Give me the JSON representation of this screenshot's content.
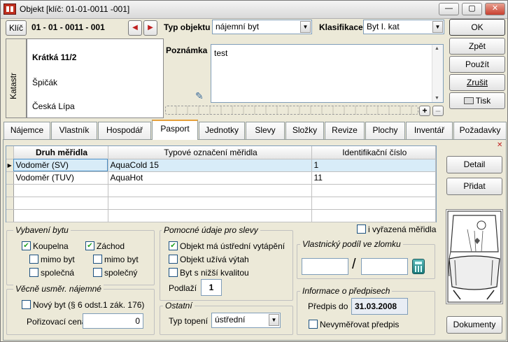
{
  "window": {
    "title": "Objekt  [klíč: 01-01-0011 -001]",
    "min_glyph": "—",
    "max_glyph": "▢",
    "close_glyph": "✕"
  },
  "header": {
    "key_button": "Klíč",
    "key_value": "01 - 01 - 0011 - 001",
    "prev_glyph": "◀",
    "next_glyph": "▶",
    "type_label": "Typ objektu",
    "type_value": "nájemní byt",
    "class_label": "Klasifikace",
    "class_value": "Byt I. kat"
  },
  "katastr": {
    "side_label": "Katastr",
    "street": "Krátká 11/2",
    "district": "Špičák",
    "city": "Česká Lípa"
  },
  "note": {
    "label": "Poznámka",
    "value": "test",
    "plus": "+",
    "minus": "–"
  },
  "actions": {
    "ok": "OK",
    "back": "Zpět",
    "use": "Použít",
    "cancel": "Zrušit",
    "print": "Tisk"
  },
  "tabs": [
    {
      "label": "Nájemce"
    },
    {
      "label": "Vlastník"
    },
    {
      "label": "Hospodář"
    },
    {
      "label": "Pasport"
    },
    {
      "label": "Jednotky"
    },
    {
      "label": "Slevy"
    },
    {
      "label": "Složky"
    },
    {
      "label": "Revize"
    },
    {
      "label": "Plochy"
    },
    {
      "label": "Inventář"
    },
    {
      "label": "Požadavky"
    }
  ],
  "meters": {
    "columns": [
      "Druh měřidla",
      "Typové označení měřidla",
      "Identifikační číslo"
    ],
    "rows": [
      {
        "type": "Vodoměr (SV)",
        "model": "AquaCold 15",
        "id": "1"
      },
      {
        "type": "Vodoměr (TUV)",
        "model": "AquaHot",
        "id": "11"
      }
    ],
    "detail_button": "Detail",
    "add_button": "Přidat",
    "include_removed": "i vyřazená měřidla"
  },
  "equipment": {
    "title": "Vybavení bytu",
    "bathroom": "Koupelna",
    "toilet": "Záchod",
    "outside_flat_1": "mimo byt",
    "outside_flat_2": "mimo byt",
    "shared_1": "společná",
    "shared_2": "společný"
  },
  "rent": {
    "title": "Věcně usměr. nájemné",
    "new_flat": "Nový byt (§  6 odst.1 zák. 176)",
    "purchase_label": "Pořizovací cena",
    "purchase_value": "0"
  },
  "discounts": {
    "title": "Pomocné údaje pro slevy",
    "central_heating": "Objekt má ústřední vytápění",
    "elevator": "Objekt užívá výtah",
    "lower_quality": "Byt s nižší kvalitou",
    "floor_label": "Podlaží",
    "floor_value": "1"
  },
  "other": {
    "title": "Ostatní",
    "heating_label": "Typ topení",
    "heating_value": "ústřední"
  },
  "ownership": {
    "title": "Vlastnický podíl ve zlomku",
    "numerator": "",
    "slash": "/",
    "denominator": ""
  },
  "prescriptions": {
    "title": "Informace o předpisech",
    "date_label": "Předpis do",
    "date_value": "31.03.2008",
    "no_measure": "Nevyměřovat předpis"
  },
  "documents_button": "Dokumenty",
  "close_x": "✕"
}
